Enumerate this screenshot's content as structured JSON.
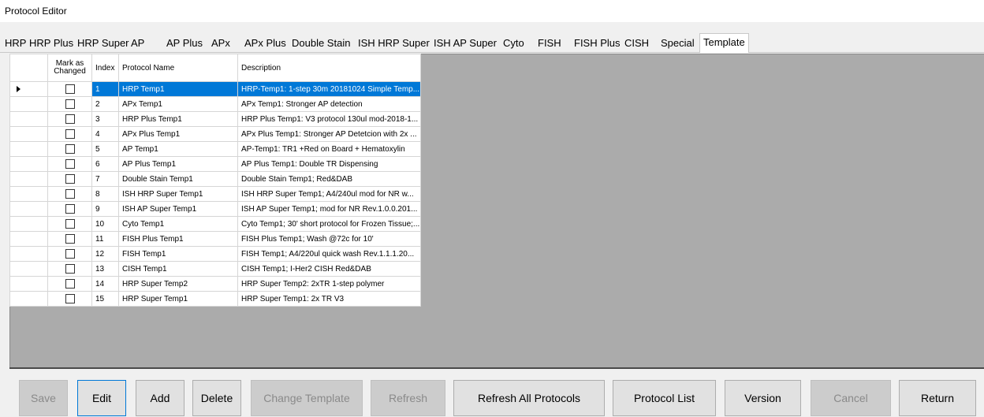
{
  "window": {
    "title": "Protocol Editor"
  },
  "tabs": [
    {
      "label": "HRP"
    },
    {
      "label": "HRP Plus"
    },
    {
      "label": "HRP Super"
    },
    {
      "label": "AP"
    },
    {
      "label": "AP Plus"
    },
    {
      "label": "APx"
    },
    {
      "label": "APx Plus"
    },
    {
      "label": "Double Stain"
    },
    {
      "label": "ISH HRP Super"
    },
    {
      "label": "ISH AP Super"
    },
    {
      "label": "Cyto"
    },
    {
      "label": "FISH"
    },
    {
      "label": "FISH Plus"
    },
    {
      "label": "CISH"
    },
    {
      "label": "Special"
    },
    {
      "label": "Template"
    }
  ],
  "active_tab": "Template",
  "grid": {
    "columns": {
      "mark": "Mark as Changed",
      "index": "Index",
      "name": "Protocol Name",
      "description": "Description"
    },
    "selected_row": 0,
    "rows": [
      {
        "index": "1",
        "name": "HRP Temp1",
        "description": "HRP-Temp1: 1-step 30m 20181024 Simple Temp...",
        "checked": false
      },
      {
        "index": "2",
        "name": "APx Temp1",
        "description": "APx Temp1: Stronger AP detection",
        "checked": false
      },
      {
        "index": "3",
        "name": "HRP Plus Temp1",
        "description": "HRP Plus Temp1: V3 protocol 130ul mod-2018-1...",
        "checked": false
      },
      {
        "index": "4",
        "name": "APx Plus Temp1",
        "description": "APx Plus Temp1: Stronger AP Detetcion with 2x ...",
        "checked": false
      },
      {
        "index": "5",
        "name": "AP Temp1",
        "description": "AP-Temp1: TR1 +Red on Board + Hematoxylin",
        "checked": false
      },
      {
        "index": "6",
        "name": "AP Plus Temp1",
        "description": "AP Plus Temp1: Double TR Dispensing",
        "checked": false
      },
      {
        "index": "7",
        "name": "Double Stain Temp1",
        "description": "Double Stain Temp1; Red&DAB",
        "checked": false
      },
      {
        "index": "8",
        "name": "ISH HRP Super Temp1",
        "description": "ISH HRP Super Temp1; A4/240ul mod for NR w...",
        "checked": false
      },
      {
        "index": "9",
        "name": "ISH AP Super Temp1",
        "description": "ISH AP Super Temp1; mod for NR Rev.1.0.0.201...",
        "checked": false
      },
      {
        "index": "10",
        "name": "Cyto Temp1",
        "description": "Cyto Temp1; 30' short protocol for Frozen Tissue;...",
        "checked": false
      },
      {
        "index": "11",
        "name": "FISH Plus Temp1",
        "description": "FISH Plus Temp1; Wash @72c for 10'",
        "checked": false
      },
      {
        "index": "12",
        "name": "FISH Temp1",
        "description": "FISH Temp1; A4/220ul quick wash Rev.1.1.1.20...",
        "checked": false
      },
      {
        "index": "13",
        "name": "CISH Temp1",
        "description": "CISH Temp1; I-Her2 CISH Red&DAB",
        "checked": false
      },
      {
        "index": "14",
        "name": "HRP Super Temp2",
        "description": "HRP Super Temp2: 2xTR 1-step polymer",
        "checked": false
      },
      {
        "index": "15",
        "name": "HRP Super Temp1",
        "description": "HRP Super Temp1: 2x TR V3",
        "checked": false
      }
    ]
  },
  "buttons": [
    {
      "label": "Save",
      "enabled": false
    },
    {
      "label": "Edit",
      "enabled": true,
      "focused": true
    },
    {
      "label": "Add",
      "enabled": true
    },
    {
      "label": "Delete",
      "enabled": true
    },
    {
      "label": "Change Template",
      "enabled": false
    },
    {
      "label": "Refresh",
      "enabled": false
    },
    {
      "label": "Refresh All Protocols",
      "enabled": true
    },
    {
      "label": "Protocol List",
      "enabled": true
    },
    {
      "label": "Version",
      "enabled": true
    },
    {
      "label": "Cancel",
      "enabled": false
    },
    {
      "label": "Return",
      "enabled": true
    }
  ],
  "colors": {
    "selection": "#0078d7",
    "grid_background": "#ababab",
    "button_face": "#e1e1e1"
  }
}
